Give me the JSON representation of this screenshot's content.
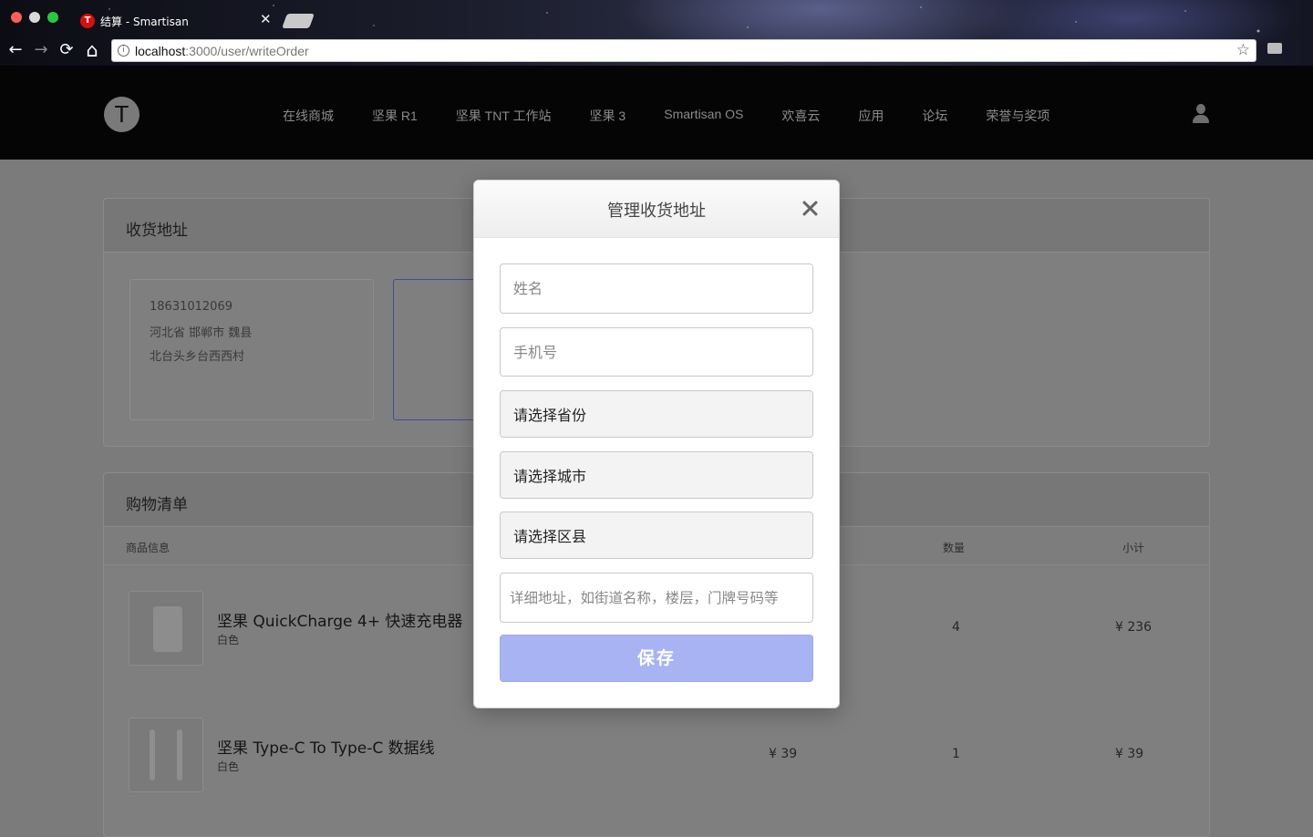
{
  "browser": {
    "tab_title": "结算 - Smartisan",
    "tab_favicon_letter": "T",
    "tab_close": "✕",
    "url_host": "localhost",
    "url_path": ":3000/user/writeOrder",
    "back_icon": "←",
    "forward_icon": "→",
    "reload_icon": "⟳",
    "home_icon": "⌂",
    "star_icon": "☆",
    "info_icon": "i"
  },
  "site": {
    "logo_letter": "T",
    "nav": [
      "在线商城",
      "坚果 R1",
      "坚果 TNT 工作站",
      "坚果 3",
      "Smartisan OS",
      "欢喜云",
      "应用",
      "论坛",
      "荣誉与奖项"
    ]
  },
  "address_panel": {
    "title": "收货地址",
    "card": {
      "phone": "18631012069",
      "region": "河北省 邯郸市 魏县",
      "street": "北台头乡台西西村"
    }
  },
  "cart_panel": {
    "title": "购物清单",
    "columns": {
      "info": "商品信息",
      "qty": "数量",
      "subtotal": "小计"
    },
    "items": [
      {
        "name": "坚果 QuickCharge 4+ 快速充电器",
        "spec": "白色",
        "price": "",
        "qty": "4",
        "subtotal": "¥ 236"
      },
      {
        "name": "坚果 Type-C To Type-C 数据线",
        "spec": "白色",
        "price": "¥ 39",
        "qty": "1",
        "subtotal": "¥ 39"
      }
    ]
  },
  "modal": {
    "title": "管理收货地址",
    "name_placeholder": "姓名",
    "phone_placeholder": "手机号",
    "province_select": "请选择省份",
    "city_select": "请选择城市",
    "district_select": "请选择区县",
    "detail_placeholder": "详细地址，如街道名称，楼层，门牌号码等",
    "save_label": "保存"
  },
  "colors": {
    "save_button": "#a8b3f4",
    "overlay": "#7b7b7b",
    "header": "#050505",
    "tab_favicon": "#d60f0f"
  }
}
